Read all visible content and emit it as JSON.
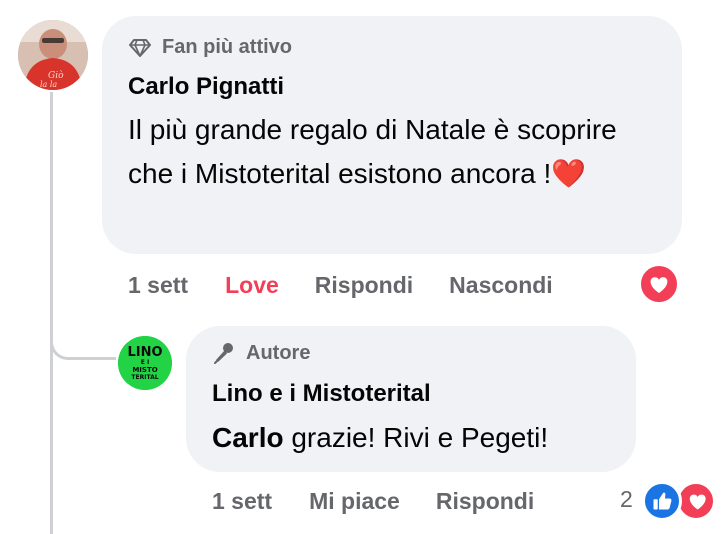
{
  "comments": [
    {
      "badge": "Fan più attivo",
      "badge_icon": "diamond-icon",
      "author": "Carlo Pignatti",
      "text": "Il più grande regalo di Natale è scoprire che i Mistoterital esistono ancora !",
      "emoji": "❤️",
      "time": "1 sett",
      "reaction_label": "Love",
      "reply": "Rispondi",
      "hide": "Nascondi",
      "reaction_icon": "love-icon",
      "reaction_color": "#f33e58"
    },
    {
      "badge": "Autore",
      "badge_icon": "microphone-icon",
      "author": "Lino e i Mistoterital",
      "avatar_text": [
        "LINO",
        "E I",
        "MISTO",
        "TERITAL"
      ],
      "mention": "Carlo",
      "text": " grazie! Rivi e Pegeti!",
      "time": "1 sett",
      "like": "Mi piace",
      "reply": "Rispondi",
      "reaction_count": "2",
      "reaction_icons": [
        "like-icon",
        "love-icon"
      ]
    }
  ]
}
